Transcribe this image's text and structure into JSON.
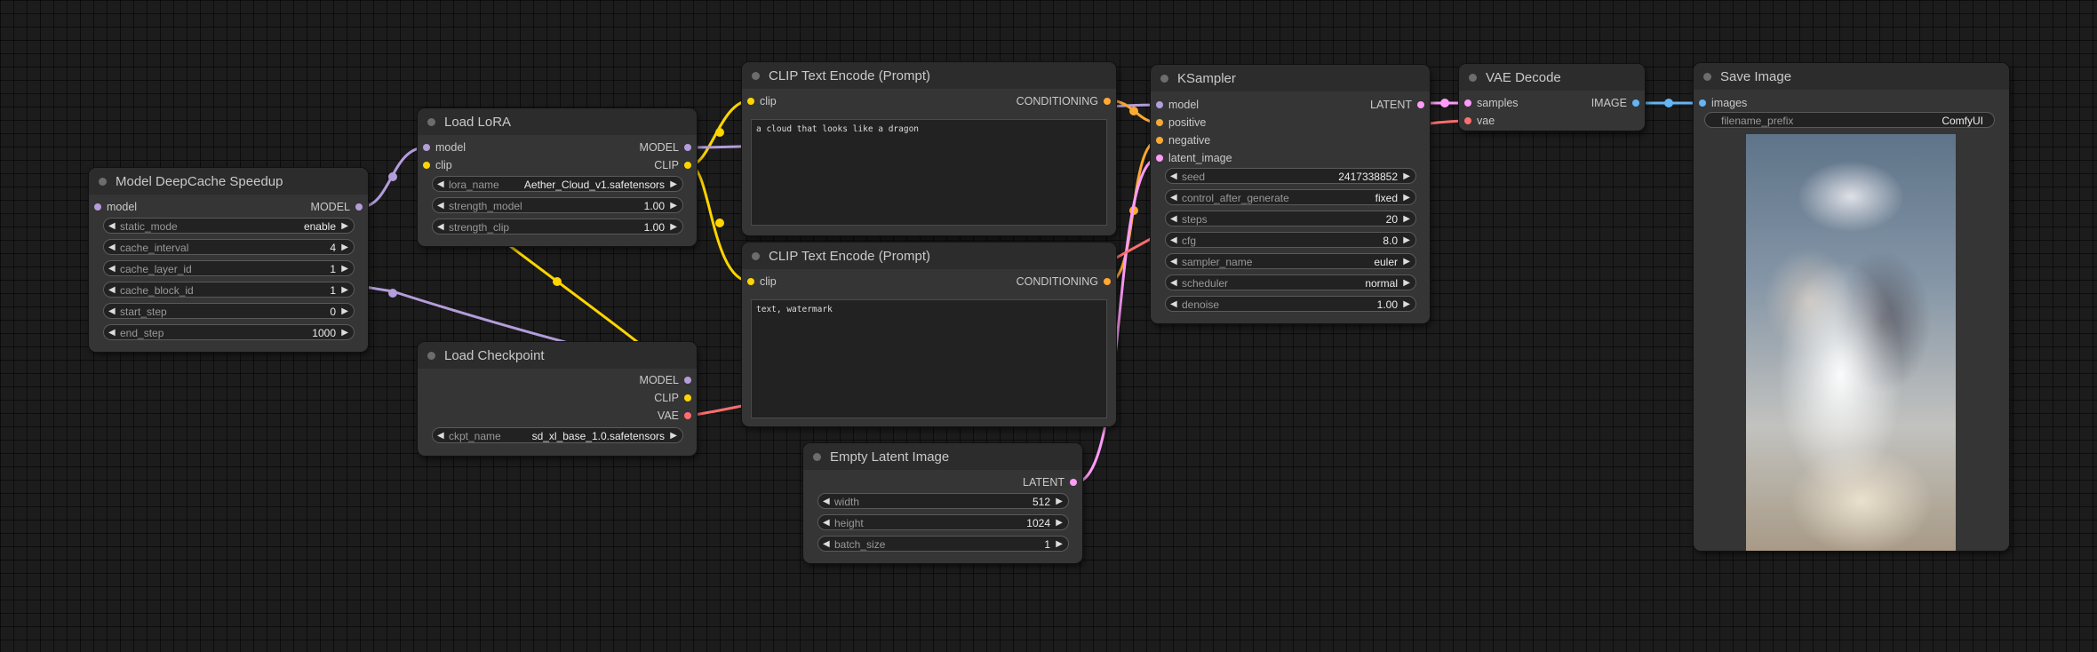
{
  "colors": {
    "model": "#b39ddb",
    "clip": "#ffd500",
    "vae": "#ff6e6e",
    "conditioning": "#ffa931",
    "latent": "#ff9cf9",
    "image": "#64b5f6"
  },
  "deepcache": {
    "title": "Model DeepCache Speedup",
    "input_model": "model",
    "output_model": "MODEL",
    "widgets": [
      {
        "name": "static_mode",
        "value": "enable"
      },
      {
        "name": "cache_interval",
        "value": "4"
      },
      {
        "name": "cache_layer_id",
        "value": "1"
      },
      {
        "name": "cache_block_id",
        "value": "1"
      },
      {
        "name": "start_step",
        "value": "0"
      },
      {
        "name": "end_step",
        "value": "1000"
      }
    ]
  },
  "lora": {
    "title": "Load LoRA",
    "input_model": "model",
    "input_clip": "clip",
    "output_model": "MODEL",
    "output_clip": "CLIP",
    "widgets": [
      {
        "name": "lora_name",
        "value": "Aether_Cloud_v1.safetensors"
      },
      {
        "name": "strength_model",
        "value": "1.00"
      },
      {
        "name": "strength_clip",
        "value": "1.00"
      }
    ]
  },
  "checkpoint": {
    "title": "Load Checkpoint",
    "output_model": "MODEL",
    "output_clip": "CLIP",
    "output_vae": "VAE",
    "widgets": [
      {
        "name": "ckpt_name",
        "value": "sd_xl_base_1.0.safetensors"
      }
    ]
  },
  "clip_pos": {
    "title": "CLIP Text Encode (Prompt)",
    "input_clip": "clip",
    "output": "CONDITIONING",
    "text": "a cloud that looks like a dragon"
  },
  "clip_neg": {
    "title": "CLIP Text Encode (Prompt)",
    "input_clip": "clip",
    "output": "CONDITIONING",
    "text": "text, watermark"
  },
  "latent": {
    "title": "Empty Latent Image",
    "output": "LATENT",
    "widgets": [
      {
        "name": "width",
        "value": "512"
      },
      {
        "name": "height",
        "value": "1024"
      },
      {
        "name": "batch_size",
        "value": "1"
      }
    ]
  },
  "ksampler": {
    "title": "KSampler",
    "inputs": [
      "model",
      "positive",
      "negative",
      "latent_image"
    ],
    "output": "LATENT",
    "widgets": [
      {
        "name": "seed",
        "value": "2417338852"
      },
      {
        "name": "control_after_generate",
        "value": "fixed"
      },
      {
        "name": "steps",
        "value": "20"
      },
      {
        "name": "cfg",
        "value": "8.0"
      },
      {
        "name": "sampler_name",
        "value": "euler"
      },
      {
        "name": "scheduler",
        "value": "normal"
      },
      {
        "name": "denoise",
        "value": "1.00"
      }
    ]
  },
  "vae_decode": {
    "title": "VAE Decode",
    "input_samples": "samples",
    "input_vae": "vae",
    "output": "IMAGE"
  },
  "save": {
    "title": "Save Image",
    "input_images": "images",
    "widgets": [
      {
        "name": "filename_prefix",
        "value": "ComfyUI"
      }
    ],
    "preview": "generated-cloud-dragon-image"
  }
}
